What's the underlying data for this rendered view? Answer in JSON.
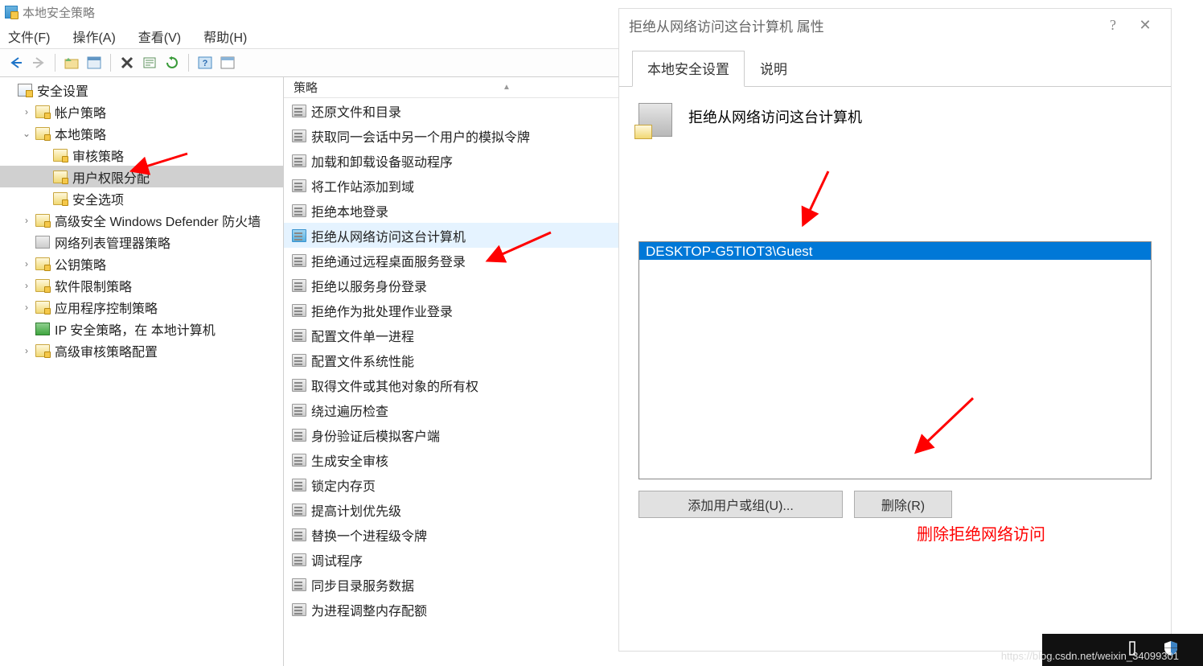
{
  "window": {
    "title": "本地安全策略",
    "menu": {
      "file": "文件(F)",
      "action": "操作(A)",
      "view": "查看(V)",
      "help": "帮助(H)"
    }
  },
  "tree": {
    "root": "安全设置",
    "items": [
      {
        "label": "帐户策略",
        "indent": 1,
        "expander": "›",
        "icon": "folder"
      },
      {
        "label": "本地策略",
        "indent": 1,
        "expander": "⌄",
        "icon": "folder"
      },
      {
        "label": "审核策略",
        "indent": 2,
        "expander": " ",
        "icon": "folder"
      },
      {
        "label": "用户权限分配",
        "indent": 2,
        "expander": " ",
        "icon": "folder",
        "selected": true
      },
      {
        "label": "安全选项",
        "indent": 2,
        "expander": " ",
        "icon": "folder"
      },
      {
        "label": "高级安全 Windows Defender 防火墙",
        "indent": 1,
        "expander": "›",
        "icon": "folder"
      },
      {
        "label": "网络列表管理器策略",
        "indent": 1,
        "expander": " ",
        "icon": "net"
      },
      {
        "label": "公钥策略",
        "indent": 1,
        "expander": "›",
        "icon": "folder"
      },
      {
        "label": "软件限制策略",
        "indent": 1,
        "expander": "›",
        "icon": "folder"
      },
      {
        "label": "应用程序控制策略",
        "indent": 1,
        "expander": "›",
        "icon": "folder"
      },
      {
        "label": "IP 安全策略，在 本地计算机",
        "indent": 1,
        "expander": " ",
        "icon": "ip"
      },
      {
        "label": "高级审核策略配置",
        "indent": 1,
        "expander": "›",
        "icon": "folder"
      }
    ]
  },
  "list": {
    "header": "策略",
    "items": [
      "还原文件和目录",
      "获取同一会话中另一个用户的模拟令牌",
      "加载和卸载设备驱动程序",
      "将工作站添加到域",
      "拒绝本地登录",
      "拒绝从网络访问这台计算机",
      "拒绝通过远程桌面服务登录",
      "拒绝以服务身份登录",
      "拒绝作为批处理作业登录",
      "配置文件单一进程",
      "配置文件系统性能",
      "取得文件或其他对象的所有权",
      "绕过遍历检查",
      "身份验证后模拟客户端",
      "生成安全审核",
      "锁定内存页",
      "提高计划优先级",
      "替换一个进程级令牌",
      "调试程序",
      "同步目录服务数据",
      "为进程调整内存配额"
    ],
    "highlight_index": 5
  },
  "dialog": {
    "title": "拒绝从网络访问这台计算机 属性",
    "help": "?",
    "close": "✕",
    "tabs": {
      "t1": "本地安全设置",
      "t2": "说明"
    },
    "policy_name": "拒绝从网络访问这台计算机",
    "listbox_item": "DESKTOP-G5TIOT3\\Guest",
    "btn_add": "添加用户或组(U)...",
    "btn_remove": "删除(R)"
  },
  "annotation": "删除拒绝网络访问",
  "watermark": "https://blog.csdn.net/weixin_34099301"
}
